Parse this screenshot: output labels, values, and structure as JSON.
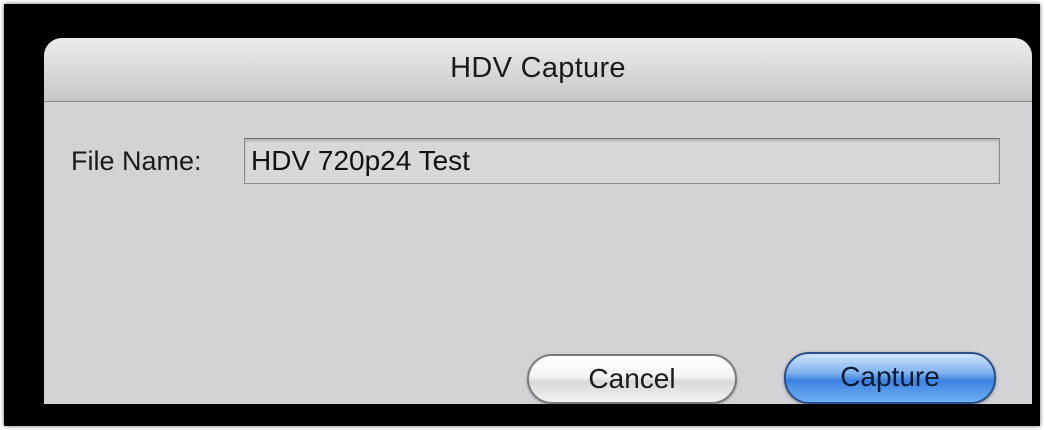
{
  "dialog": {
    "title": "HDV Capture"
  },
  "form": {
    "file_name_label": "File Name:",
    "file_name_value": "HDV 720p24 Test"
  },
  "buttons": {
    "cancel_label": "Cancel",
    "capture_label": "Capture"
  },
  "colors": {
    "window_frame": "#000000",
    "dialog_background": "#d3d3d5",
    "default_button_accent": "#3d82e1"
  }
}
